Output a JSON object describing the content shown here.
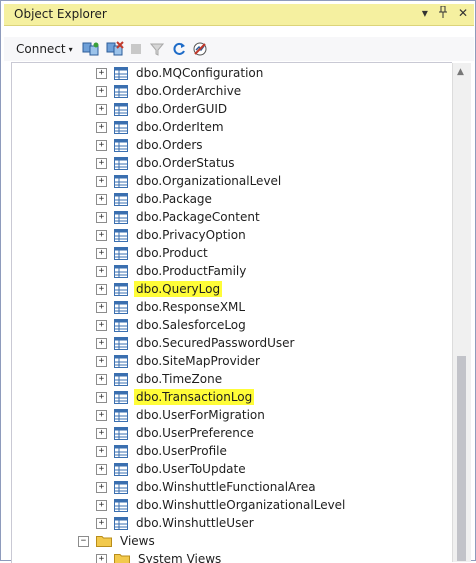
{
  "panel": {
    "title": "Object Explorer",
    "title_buttons": [
      "▾",
      "📌",
      "✕"
    ]
  },
  "toolbar": {
    "connect_label": "Connect",
    "connect_caret": "▾"
  },
  "colors": {
    "title_bg": "#f5f0a0",
    "highlight": "#fffd38",
    "table_icon": "#3a6fb0"
  },
  "tree": {
    "tables": [
      {
        "name": "dbo.MQConfiguration",
        "highlighted": false
      },
      {
        "name": "dbo.OrderArchive",
        "highlighted": false
      },
      {
        "name": "dbo.OrderGUID",
        "highlighted": false
      },
      {
        "name": "dbo.OrderItem",
        "highlighted": false
      },
      {
        "name": "dbo.Orders",
        "highlighted": false
      },
      {
        "name": "dbo.OrderStatus",
        "highlighted": false
      },
      {
        "name": "dbo.OrganizationalLevel",
        "highlighted": false
      },
      {
        "name": "dbo.Package",
        "highlighted": false
      },
      {
        "name": "dbo.PackageContent",
        "highlighted": false
      },
      {
        "name": "dbo.PrivacyOption",
        "highlighted": false
      },
      {
        "name": "dbo.Product",
        "highlighted": false
      },
      {
        "name": "dbo.ProductFamily",
        "highlighted": false
      },
      {
        "name": "dbo.QueryLog",
        "highlighted": true
      },
      {
        "name": "dbo.ResponseXML",
        "highlighted": false
      },
      {
        "name": "dbo.SalesforceLog",
        "highlighted": false
      },
      {
        "name": "dbo.SecuredPasswordUser",
        "highlighted": false
      },
      {
        "name": "dbo.SiteMapProvider",
        "highlighted": false
      },
      {
        "name": "dbo.TimeZone",
        "highlighted": false
      },
      {
        "name": "dbo.TransactionLog",
        "highlighted": true
      },
      {
        "name": "dbo.UserForMigration",
        "highlighted": false
      },
      {
        "name": "dbo.UserPreference",
        "highlighted": false
      },
      {
        "name": "dbo.UserProfile",
        "highlighted": false
      },
      {
        "name": "dbo.UserToUpdate",
        "highlighted": false
      },
      {
        "name": "dbo.WinshuttleFunctionalArea",
        "highlighted": false
      },
      {
        "name": "dbo.WinshuttleOrganizationalLevel",
        "highlighted": false
      },
      {
        "name": "dbo.WinshuttleUser",
        "highlighted": false
      }
    ],
    "views_label": "Views",
    "system_views_label": "System Views"
  }
}
